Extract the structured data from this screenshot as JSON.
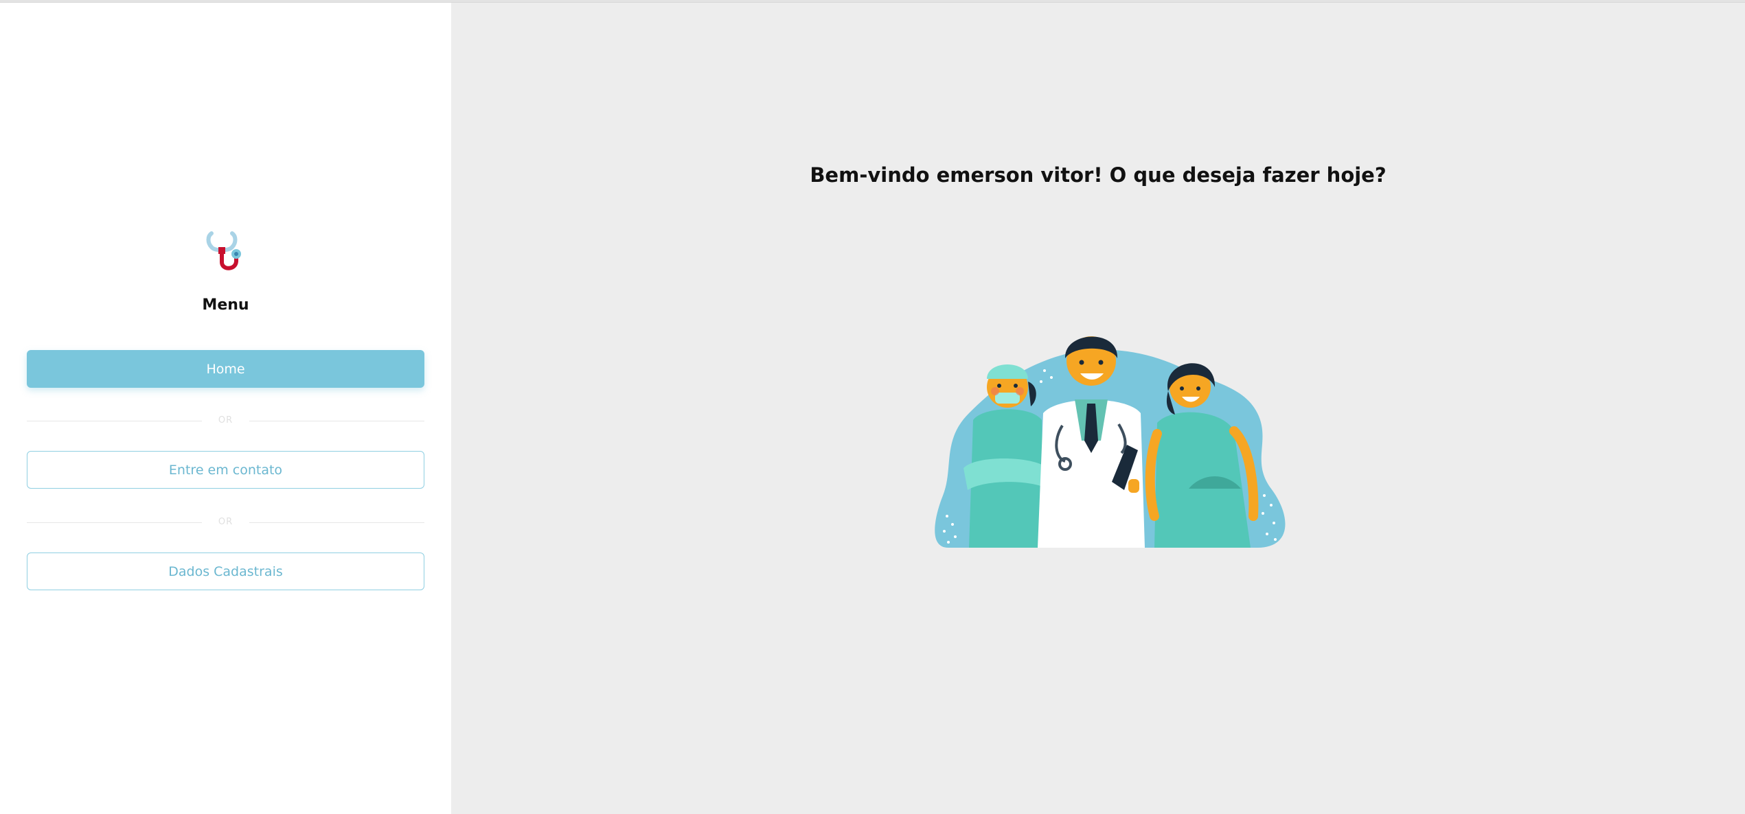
{
  "sidebar": {
    "logo_icon": "stethoscope-icon",
    "menu_title": "Menu",
    "buttons": {
      "home": "Home",
      "contact": "Entre em contato",
      "dados": "Dados Cadastrais"
    },
    "divider_text": "OR"
  },
  "main": {
    "welcome": "Bem-vindo emerson vitor! O que deseja fazer hoje?",
    "illustration_icon": "medical-team-illustration"
  },
  "colors": {
    "accent": "#7ac6dc",
    "main_bg": "#ededed",
    "logo_red": "#c8102e"
  }
}
